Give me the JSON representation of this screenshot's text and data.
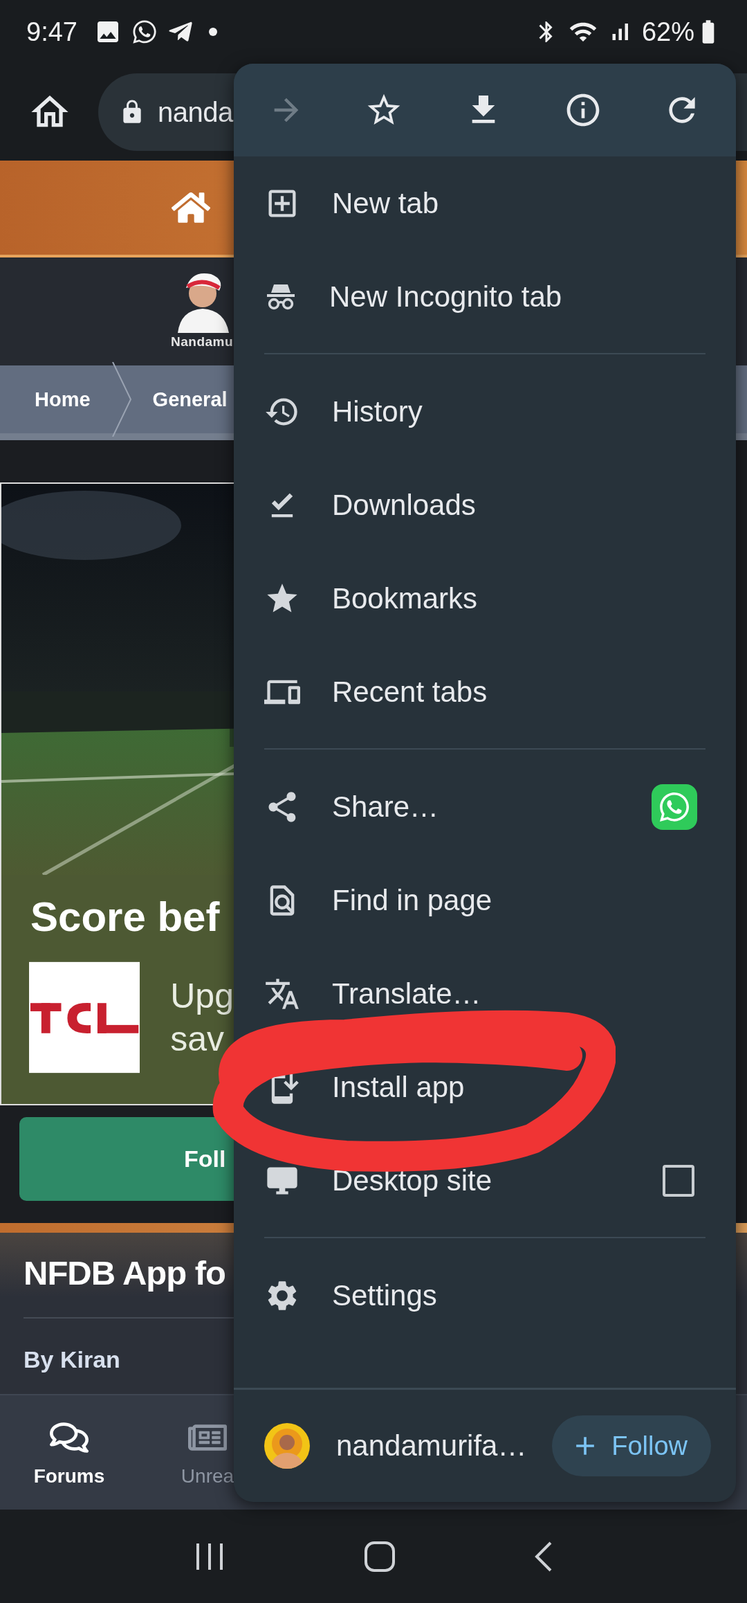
{
  "status_bar": {
    "time": "9:47",
    "battery": "62%"
  },
  "toolbar": {
    "url": "nanda"
  },
  "page": {
    "logo_caption": "Nandamu",
    "breadcrumbs": [
      "Home",
      "General"
    ],
    "ad": {
      "headline": "Score bef",
      "body_lines": [
        "Upg",
        "sav"
      ]
    },
    "follow_button": "Foll",
    "thread_title": "NFDB App fo",
    "author": "By Kiran"
  },
  "bottom_nav": [
    {
      "label": "Forums",
      "selected": true
    },
    {
      "label": "Unrea",
      "selected": false
    }
  ],
  "menu": {
    "actions": [
      {
        "disabled": true
      },
      {
        "disabled": false
      },
      {
        "disabled": false
      },
      {
        "disabled": false
      },
      {
        "disabled": false
      }
    ],
    "sections": [
      [
        {
          "kind": "plain",
          "label": "New tab"
        },
        {
          "kind": "plain",
          "label": "New Incognito tab"
        }
      ],
      [
        {
          "kind": "plain",
          "label": "History"
        },
        {
          "kind": "plain",
          "label": "Downloads"
        },
        {
          "kind": "plain",
          "label": "Bookmarks"
        },
        {
          "kind": "plain",
          "label": "Recent tabs"
        }
      ],
      [
        {
          "kind": "share",
          "label": "Share…"
        },
        {
          "kind": "plain",
          "label": "Find in page"
        },
        {
          "kind": "plain",
          "label": "Translate…"
        },
        {
          "kind": "plain",
          "label": "Install app"
        },
        {
          "kind": "checkbox",
          "label": "Desktop site",
          "checked": false
        }
      ],
      [
        {
          "kind": "plain",
          "label": "Settings"
        }
      ]
    ],
    "footer": {
      "site": "nandamurifa…",
      "follow": "Follow"
    }
  }
}
